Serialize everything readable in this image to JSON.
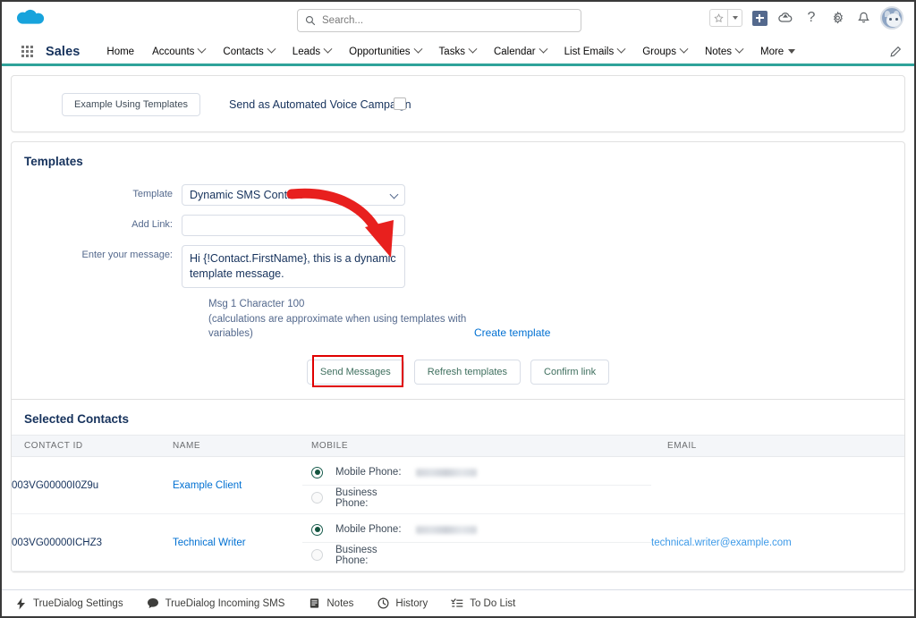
{
  "header": {
    "logo_icon": "salesforce-cloud-icon",
    "search": {
      "placeholder": "Search...",
      "value": "",
      "icon": "search-icon"
    },
    "icons": [
      {
        "name": "favorites-star-icon",
        "glyph": "star"
      },
      {
        "name": "favorites-dropdown-icon",
        "glyph": "caret-down"
      },
      {
        "name": "global-actions-plus-icon",
        "glyph": "plus"
      },
      {
        "name": "service-cloud-icon",
        "glyph": "cloud"
      },
      {
        "name": "help-icon",
        "glyph": "?"
      },
      {
        "name": "setup-gear-icon",
        "glyph": "gear"
      },
      {
        "name": "notifications-bell-icon",
        "glyph": "bell"
      },
      {
        "name": "user-avatar",
        "glyph": "avatar"
      }
    ]
  },
  "appnav": {
    "app_name": "Sales",
    "waffle_icon": "app-launcher-icon",
    "edit_icon": "pencil-icon",
    "items": [
      {
        "label": "Home",
        "caret": false
      },
      {
        "label": "Accounts",
        "caret": true
      },
      {
        "label": "Contacts",
        "caret": true
      },
      {
        "label": "Leads",
        "caret": true
      },
      {
        "label": "Opportunities",
        "caret": true
      },
      {
        "label": "Tasks",
        "caret": true
      },
      {
        "label": "Calendar",
        "caret": true
      },
      {
        "label": "List Emails",
        "caret": true
      },
      {
        "label": "Groups",
        "caret": true
      },
      {
        "label": "Notes",
        "caret": true
      },
      {
        "label": "More",
        "caret": "solid"
      }
    ]
  },
  "top_card": {
    "example_button": "Example Using Templates",
    "voice_campaign_label": "Send as Automated Voice Campaign",
    "voice_campaign_checked": false
  },
  "templates": {
    "section_title": "Templates",
    "template_label": "Template",
    "template_value": "Dynamic SMS Contact",
    "template_options": [
      "Dynamic SMS Contact"
    ],
    "add_link_label": "Add Link:",
    "add_link_value": "",
    "message_label": "Enter your message:",
    "message_value": "Hi {!Contact.FirstName}, this is a dynamic template message.",
    "create_template_link": "Create template",
    "char_count_line1": "Msg 1 Character 100",
    "char_count_line2": "(calculations are approximate when using templates with variables)",
    "buttons": {
      "send": "Send Messages",
      "refresh": "Refresh templates",
      "confirm": "Confirm link"
    },
    "highlight_color": "#e00000"
  },
  "contacts": {
    "section_title": "Selected Contacts",
    "columns": [
      "CONTACT ID",
      "NAME",
      "MOBILE",
      "EMAIL"
    ],
    "mobile_label": "Mobile Phone:",
    "business_label": "Business Phone:",
    "rows": [
      {
        "contact_id": "003VG00000I0Z9u",
        "name": "Example Client",
        "mobile_selected": true,
        "mobile_number": "",
        "business_number": "",
        "email": ""
      },
      {
        "contact_id": "003VG00000ICHZ3",
        "name": "Technical Writer",
        "mobile_selected": true,
        "mobile_number": "",
        "business_number": "",
        "email": "technical.writer@example.com"
      }
    ]
  },
  "utility_bar": {
    "items": [
      {
        "label": "TrueDialog Settings",
        "icon": "lightning-icon"
      },
      {
        "label": "TrueDialog Incoming SMS",
        "icon": "chat-bubble-icon"
      },
      {
        "label": "Notes",
        "icon": "notes-icon"
      },
      {
        "label": "History",
        "icon": "clock-icon"
      },
      {
        "label": "To Do List",
        "icon": "todo-list-icon"
      }
    ]
  },
  "annotation": {
    "arrow_color": "#e8201e",
    "arrow_description": "red curved arrow from template dropdown to message box"
  },
  "theme": {
    "accent_teal": "#2fa39a",
    "link_blue": "#0070d2",
    "text_navy": "#16325c"
  }
}
